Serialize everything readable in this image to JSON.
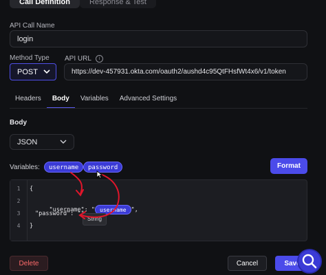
{
  "tabs": [
    {
      "label": "Call Definition"
    },
    {
      "label": "Response & Test"
    }
  ],
  "api_call_name": {
    "label": "API Call Name",
    "value": "login"
  },
  "method": {
    "label": "Method Type",
    "value": "POST"
  },
  "api_url": {
    "label": "API URL",
    "info_icon_text": "i",
    "value": "https://dev-457931.okta.com/oauth2/aushd4c95QtFHsfWt4x6/v1/token"
  },
  "subtabs": [
    {
      "label": "Headers"
    },
    {
      "label": "Body"
    },
    {
      "label": "Variables"
    },
    {
      "label": "Advanced Settings"
    }
  ],
  "body": {
    "label": "Body",
    "format": "JSON"
  },
  "variables": {
    "label": "Variables:",
    "items": [
      "username",
      "password"
    ],
    "format_button": "Format"
  },
  "editor": {
    "line_numbers": [
      "1",
      "2",
      "3",
      "4"
    ],
    "line1": "{",
    "line2_prefix": "\"username\": \"",
    "line2_suffix": "\",",
    "line3": "\"password\": \"\"",
    "line4": "}",
    "inserted_variable": "username",
    "tooltip": "String"
  },
  "footer": {
    "delete": "Delete",
    "cancel": "Cancel",
    "save": "Save"
  },
  "colors": {
    "accent": "#4b4bea",
    "annotation": "#e0162b",
    "delete": "#ff6b6b"
  }
}
